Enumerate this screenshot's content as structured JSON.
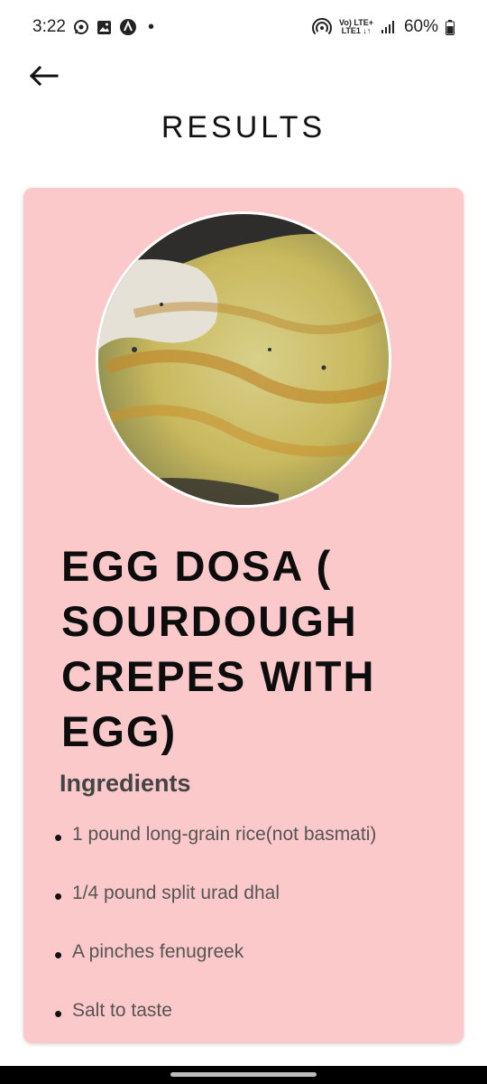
{
  "status_bar": {
    "time": "3:22",
    "icons": [
      "whatsapp-icon",
      "gallery-icon",
      "app-icon",
      "notification-dot",
      "hotspot-icon",
      "lte-icon",
      "signal-icon",
      "battery-icon"
    ],
    "lte_top": "Vo) LTE+",
    "lte_bottom": "LTE1 ↓↑",
    "battery": "60%"
  },
  "header": {
    "back_icon": "arrow-left-icon",
    "title": "RESULTS"
  },
  "recipe": {
    "name": "EGG DOSA ( SOURDOUGH CREPES WITH EGG)",
    "image": "egg-dosa-photo",
    "ingredients_title": "Ingredients",
    "ingredients": [
      "1 pound long-grain rice(not basmati)",
      "1/4 pound split urad dhal",
      "A pinches fenugreek",
      "Salt to taste"
    ]
  },
  "colors": {
    "card_bg": "#fbc9c9",
    "title": "#111111",
    "ingredient_text": "#555555"
  }
}
